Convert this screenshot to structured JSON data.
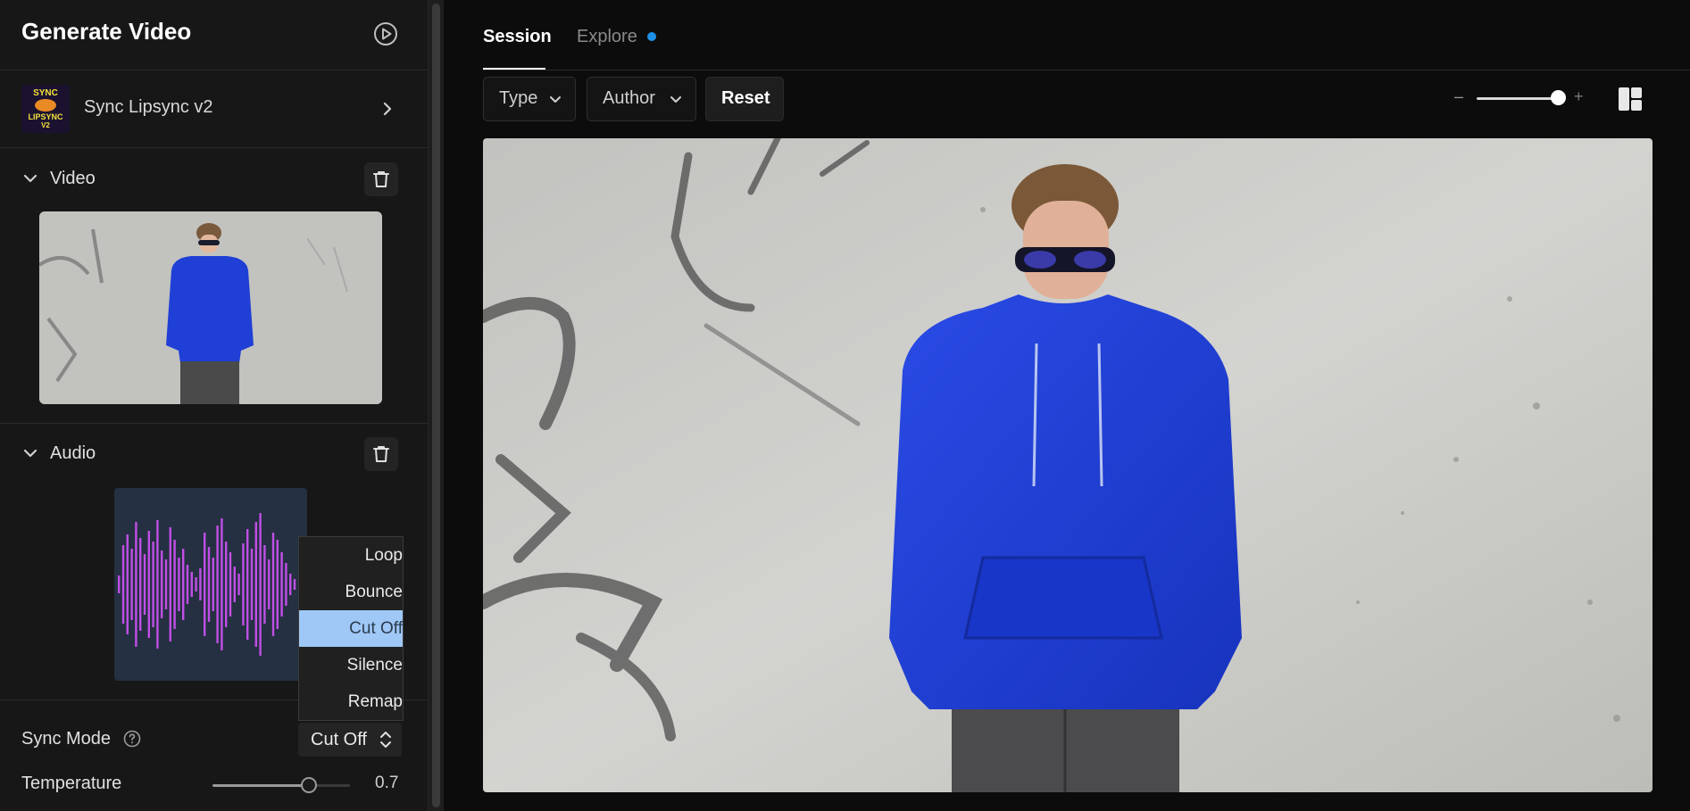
{
  "sidebar": {
    "title": "Generate Video",
    "model": {
      "name": "Sync Lipsync v2",
      "thumb_lines": [
        "SYNC",
        "LIPSYNC",
        "V2"
      ]
    },
    "video_section": {
      "label": "Video"
    },
    "audio_section": {
      "label": "Audio"
    },
    "sync_mode": {
      "label": "Sync Mode",
      "value": "Cut Off",
      "options": [
        "Loop",
        "Bounce",
        "Cut Off",
        "Silence",
        "Remap"
      ],
      "selected_index": 2
    },
    "temperature": {
      "label": "Temperature",
      "value": "0.7",
      "fraction": 0.7
    }
  },
  "main": {
    "tabs": [
      {
        "label": "Session",
        "active": true
      },
      {
        "label": "Explore",
        "active": false,
        "has_dot": true
      }
    ],
    "filters": {
      "type_label": "Type",
      "author_label": "Author",
      "reset_label": "Reset"
    },
    "zoom": {
      "minus": "–",
      "plus": "+",
      "level": 0.92
    }
  },
  "colors": {
    "accent_dot": "#1e90e8",
    "hoodie": "#1f3fd6",
    "waveform": "#c04fe6",
    "dropdown_selected": "#9fc8f7"
  },
  "icons": {
    "header": "play-circle-icon",
    "model": "chevron-right-icon",
    "sections": "chevron-down-icon",
    "delete": "trash-icon",
    "help": "help-circle-icon",
    "select": "up-down-chevron-icon",
    "layout": "layout-grid-icon"
  }
}
